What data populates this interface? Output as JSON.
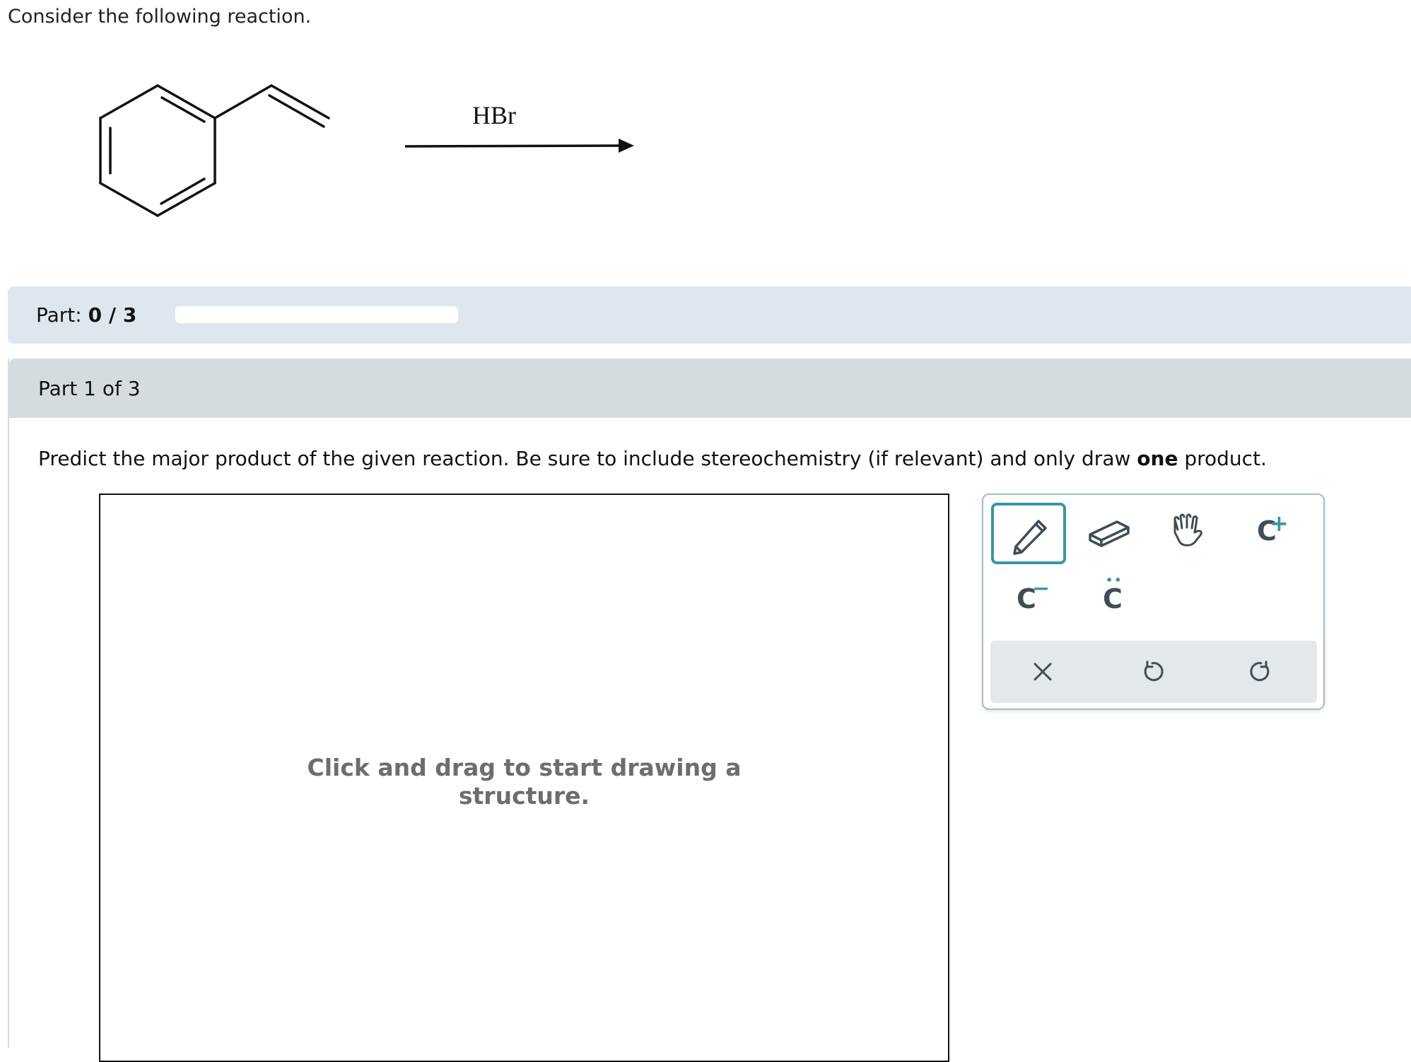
{
  "prompt": {
    "intro_text": "Consider the following reaction."
  },
  "reaction": {
    "reagent": "HBr"
  },
  "progress": {
    "label_prefix": "Part:",
    "value": "0 / 3",
    "fraction": 0
  },
  "question": {
    "header": "Part 1 of 3",
    "instruction_before": "Predict the major product of the given reaction. Be sure to include stereochemistry (if relevant) and only draw ",
    "instruction_emphasis": "one",
    "instruction_after": " product."
  },
  "canvas": {
    "hint_line1": "Click and drag to start drawing a",
    "hint_line2": "structure."
  },
  "toolbar": {
    "tools": [
      {
        "icon": "pencil-icon",
        "active": true
      },
      {
        "icon": "eraser-icon",
        "active": false
      },
      {
        "icon": "hand-icon",
        "active": false
      },
      {
        "icon": "positive-charge-icon",
        "symbol": "C",
        "superscript": "+"
      },
      {
        "icon": "negative-charge-icon",
        "symbol": "C",
        "superscript": "−"
      },
      {
        "icon": "lone-pair-icon",
        "symbol": "C",
        "superscript": "••"
      }
    ],
    "actions": [
      {
        "icon": "clear-icon"
      },
      {
        "icon": "undo-icon"
      },
      {
        "icon": "redo-icon"
      }
    ],
    "colors": {
      "accent": "#3a95a8",
      "icon": "#3f4d55",
      "action_bar": "#e2e8eb"
    }
  },
  "colors": {
    "part_bar": "#dfe7ee",
    "section_header": "#d5dcdf"
  }
}
